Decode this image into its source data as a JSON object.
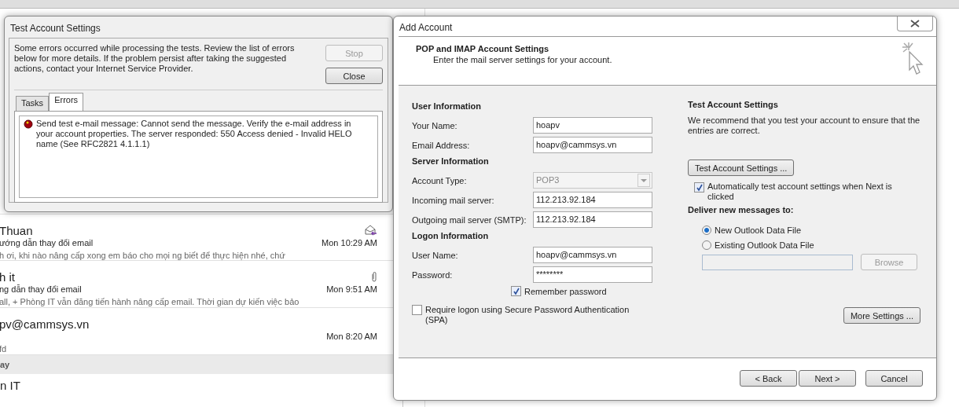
{
  "mail_list": {
    "items": [
      {
        "sender": "Thuan",
        "subject": "ướng dẫn thay đổi email",
        "preview": "h ơi, khi nào nâng cấp xong em báo cho mọi ng biết để thực hiện nhé, chứ",
        "time": "Mon 10:29 AM",
        "kind": "replied"
      },
      {
        "sender": "h it",
        "subject": "ng dẫn thay đổi email",
        "preview": "all,  + Phòng IT vẫn đăng tiến hành nâng cấp email. Thời gian dự kiến việc bảo",
        "time": "Mon 9:51 AM",
        "kind": "attachment"
      },
      {
        "sender": "pv@cammsys.vn",
        "preview": "fd",
        "time": "Mon 8:20 AM",
        "kind": "plain"
      }
    ],
    "group_header": "ay",
    "next_sender": "n IT"
  },
  "test_dialog": {
    "title": "Test Account Settings",
    "message": "Some errors occurred while processing the tests. Review the list of errors below for more details. If the problem persist after taking the suggested actions, contact your Internet Service Provider.",
    "buttons": [
      {
        "label": "Stop",
        "disabled": true
      },
      {
        "label": "Close",
        "disabled": false
      }
    ],
    "tabs": [
      {
        "label": "Tasks",
        "selected": false
      },
      {
        "label": "Errors",
        "selected": true
      }
    ],
    "errors": [
      "Send test e-mail message: Cannot send the message. Verify the e-mail address in your account properties.  The server responded: 550 Access denied - Invalid HELO name (See RFC2821 4.1.1.1)"
    ]
  },
  "add_account": {
    "title": "Add Account",
    "header": {
      "title": "POP and IMAP Account Settings",
      "subtitle": "Enter the mail server settings for your account."
    },
    "sections": [
      {
        "heading": "User Information",
        "fields": [
          {
            "label": "Your Name:",
            "value": "hoapv",
            "kind": "text"
          },
          {
            "label": "Email Address:",
            "value": "hoapv@cammsys.vn",
            "kind": "text"
          }
        ]
      },
      {
        "heading": "Server Information",
        "fields": [
          {
            "label": "Account Type:",
            "value": "POP3",
            "kind": "dropdown",
            "disabled": true
          },
          {
            "label": "Incoming mail server:",
            "value": "112.213.92.184",
            "kind": "text"
          },
          {
            "label": "Outgoing mail server (SMTP):",
            "value": "112.213.92.184",
            "kind": "text"
          }
        ]
      },
      {
        "heading": "Logon Information",
        "fields": [
          {
            "label": "User Name:",
            "value": "hoapv@cammsys.vn",
            "kind": "text"
          },
          {
            "label": "Password:",
            "value": "********",
            "kind": "text"
          }
        ]
      }
    ],
    "remember_password": {
      "label": "Remember password",
      "checked": true
    },
    "spa": {
      "label": "Require logon using Secure Password Authentication (SPA)",
      "checked": false
    },
    "test_heading": "Test Account Settings",
    "test_description": "We recommend that you test your account to ensure that the entries are correct.",
    "test_button": "Test Account Settings ...",
    "auto_test": {
      "label": "Automatically test account settings when Next is clicked",
      "checked": true
    },
    "deliver_heading": "Deliver new messages to:",
    "deliver_options": [
      {
        "label": "New Outlook Data File",
        "selected": true
      },
      {
        "label": "Existing Outlook Data File",
        "selected": false
      }
    ],
    "browse_button": {
      "label": "Browse",
      "disabled": true
    },
    "more_settings": "More Settings ...",
    "footer_buttons": [
      "< Back",
      "Next >",
      "Cancel"
    ]
  }
}
